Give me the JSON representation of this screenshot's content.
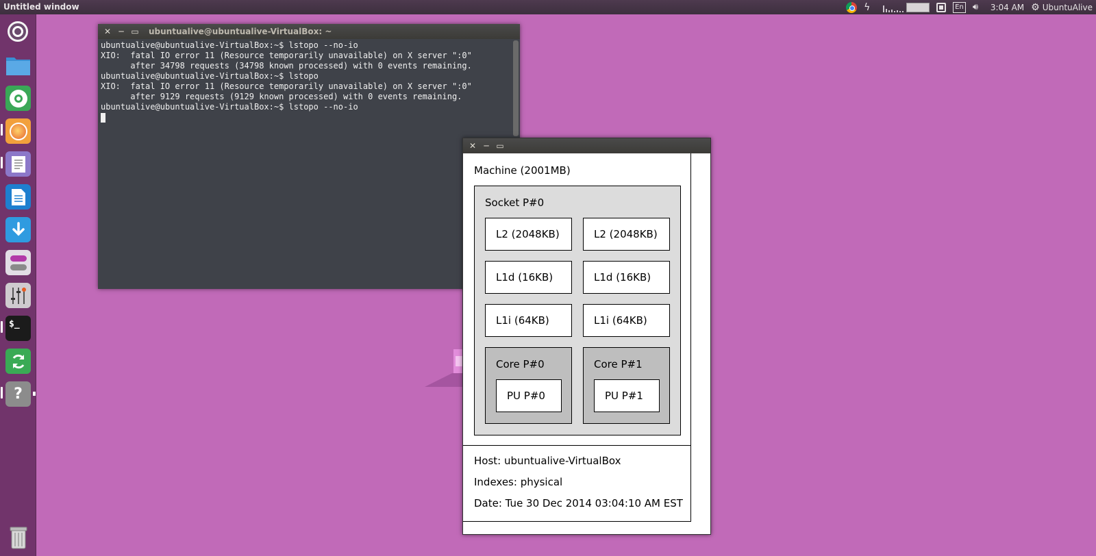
{
  "top_panel": {
    "window_title": "Untitled window",
    "clock": "3:04 AM",
    "user": "UbuntuAlive",
    "keyboard": "En"
  },
  "launcher": {
    "items": [
      {
        "name": "ubuntu-dash",
        "icon": "ubuntu-logo"
      },
      {
        "name": "files",
        "icon": "folder-icon"
      },
      {
        "name": "chrome",
        "icon": "chrome-icon"
      },
      {
        "name": "firefox",
        "icon": "firefox-icon"
      },
      {
        "name": "text-editor",
        "icon": "document-icon"
      },
      {
        "name": "writer",
        "icon": "writer-icon"
      },
      {
        "name": "downloader",
        "icon": "download-icon"
      },
      {
        "name": "settings",
        "icon": "toggle-icon"
      },
      {
        "name": "mixer",
        "icon": "mixer-icon"
      },
      {
        "name": "terminal",
        "icon": "terminal-icon",
        "label": "$_"
      },
      {
        "name": "updater",
        "icon": "sync-icon"
      },
      {
        "name": "help",
        "icon": "help-icon",
        "label": "?"
      },
      {
        "name": "trash",
        "icon": "trash-icon"
      }
    ]
  },
  "terminal": {
    "title": "ubuntualive@ubuntualive-VirtualBox: ~",
    "lines": [
      "ubuntualive@ubuntualive-VirtualBox:~$ lstopo --no-io",
      "XIO:  fatal IO error 11 (Resource temporarily unavailable) on X server \":0\"",
      "      after 34798 requests (34798 known processed) with 0 events remaining.",
      "ubuntualive@ubuntualive-VirtualBox:~$ lstopo",
      "XIO:  fatal IO error 11 (Resource temporarily unavailable) on X server \":0\"",
      "      after 9129 requests (9129 known processed) with 0 events remaining.",
      "ubuntualive@ubuntualive-VirtualBox:~$ lstopo --no-io"
    ]
  },
  "lstopo": {
    "machine": "Machine (2001MB)",
    "socket": "Socket P#0",
    "l2": [
      "L2 (2048KB)",
      "L2 (2048KB)"
    ],
    "l1d": [
      "L1d (16KB)",
      "L1d (16KB)"
    ],
    "l1i": [
      "L1i (64KB)",
      "L1i (64KB)"
    ],
    "cores": [
      {
        "label": "Core P#0",
        "pu": "PU P#0"
      },
      {
        "label": "Core P#1",
        "pu": "PU P#1"
      }
    ],
    "host": "Host: ubuntualive-VirtualBox",
    "indexes": "Indexes: physical",
    "date": "Date: Tue 30 Dec 2014 03:04:10 AM EST"
  },
  "colors": {
    "desktop": "#c16ab8",
    "socket_fill": "#dcdcdc",
    "core_fill": "#bebebe",
    "terminal_bg": "#3f4249"
  }
}
